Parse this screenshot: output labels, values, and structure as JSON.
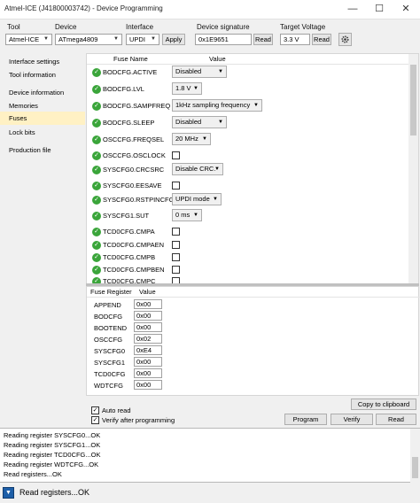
{
  "window": {
    "title": "Atmel-ICE (J41800003742) - Device Programming",
    "minimize_glyph": "—",
    "maximize_glyph": "☐",
    "close_glyph": "✕"
  },
  "toolbar": {
    "tool_label": "Tool",
    "tool_value": "Atmel-ICE",
    "device_label": "Device",
    "device_value": "ATmega4809",
    "interface_label": "Interface",
    "interface_value": "UPDI",
    "apply_label": "Apply",
    "signature_label": "Device signature",
    "signature_value": "0x1E9651",
    "read_signature_label": "Read",
    "voltage_label": "Target Voltage",
    "voltage_value": "3.3 V",
    "read_voltage_label": "Read",
    "settings_icon": "gear-icon"
  },
  "sidebar": {
    "items": [
      {
        "label": "Interface settings"
      },
      {
        "label": "Tool information"
      },
      {
        "label": "Device information"
      },
      {
        "label": "Memories"
      },
      {
        "label": "Fuses"
      },
      {
        "label": "Lock bits"
      },
      {
        "label": "Production file"
      }
    ],
    "selected": "Fuses"
  },
  "fuses": {
    "col_name": "Fuse Name",
    "col_value": "Value",
    "rows": [
      {
        "name": "BODCFG.ACTIVE",
        "type": "combo",
        "value": "Disabled"
      },
      {
        "name": "BODCFG.LVL",
        "type": "combo",
        "value": "1.8 V"
      },
      {
        "name": "BODCFG.SAMPFREQ",
        "type": "combo",
        "value": "1kHz sampling frequency"
      },
      {
        "name": "BODCFG.SLEEP",
        "type": "combo",
        "value": "Disabled"
      },
      {
        "name": "OSCCFG.FREQSEL",
        "type": "combo",
        "value": "20 MHz"
      },
      {
        "name": "OSCCFG.OSCLOCK",
        "type": "check",
        "checked": false
      },
      {
        "name": "SYSCFG0.CRCSRC",
        "type": "combo",
        "value": "Disable CRC."
      },
      {
        "name": "SYSCFG0.EESAVE",
        "type": "check",
        "checked": false
      },
      {
        "name": "SYSCFG0.RSTPINCFG",
        "type": "combo",
        "value": "UPDI mode"
      },
      {
        "name": "SYSCFG1.SUT",
        "type": "combo",
        "value": "0 ms"
      },
      {
        "name": "TCD0CFG.CMPA",
        "type": "check",
        "checked": false
      },
      {
        "name": "TCD0CFG.CMPAEN",
        "type": "check",
        "checked": false
      },
      {
        "name": "TCD0CFG.CMPB",
        "type": "check",
        "checked": false
      },
      {
        "name": "TCD0CFG.CMPBEN",
        "type": "check",
        "checked": false
      },
      {
        "name": "TCD0CFG.CMPC",
        "type": "check",
        "checked": false
      }
    ]
  },
  "registers": {
    "col_name": "Fuse Register",
    "col_value": "Value",
    "rows": [
      {
        "name": "APPEND",
        "value": "0x00"
      },
      {
        "name": "BODCFG",
        "value": "0x00"
      },
      {
        "name": "BOOTEND",
        "value": "0x00"
      },
      {
        "name": "OSCCFG",
        "value": "0x02"
      },
      {
        "name": "SYSCFG0",
        "value": "0xE4"
      },
      {
        "name": "SYSCFG1",
        "value": "0x00"
      },
      {
        "name": "TCD0CFG",
        "value": "0x00"
      },
      {
        "name": "WDTCFG",
        "value": "0x00"
      }
    ]
  },
  "actions": {
    "copy_label": "Copy to clipboard",
    "auto_read_label": "Auto read",
    "auto_read_checked": true,
    "verify_after_label": "Verify after programming",
    "verify_after_checked": true,
    "program_label": "Program",
    "verify_label": "Verify",
    "read_label": "Read"
  },
  "log": {
    "lines": [
      "Reading register SYSCFG0...OK",
      "Reading register SYSCFG1...OK",
      "Reading register TCD0CFG...OK",
      "Reading register WDTCFG...OK",
      "Read registers...OK"
    ]
  },
  "status": {
    "text": "Read registers...OK",
    "expand_glyph": "▼"
  }
}
